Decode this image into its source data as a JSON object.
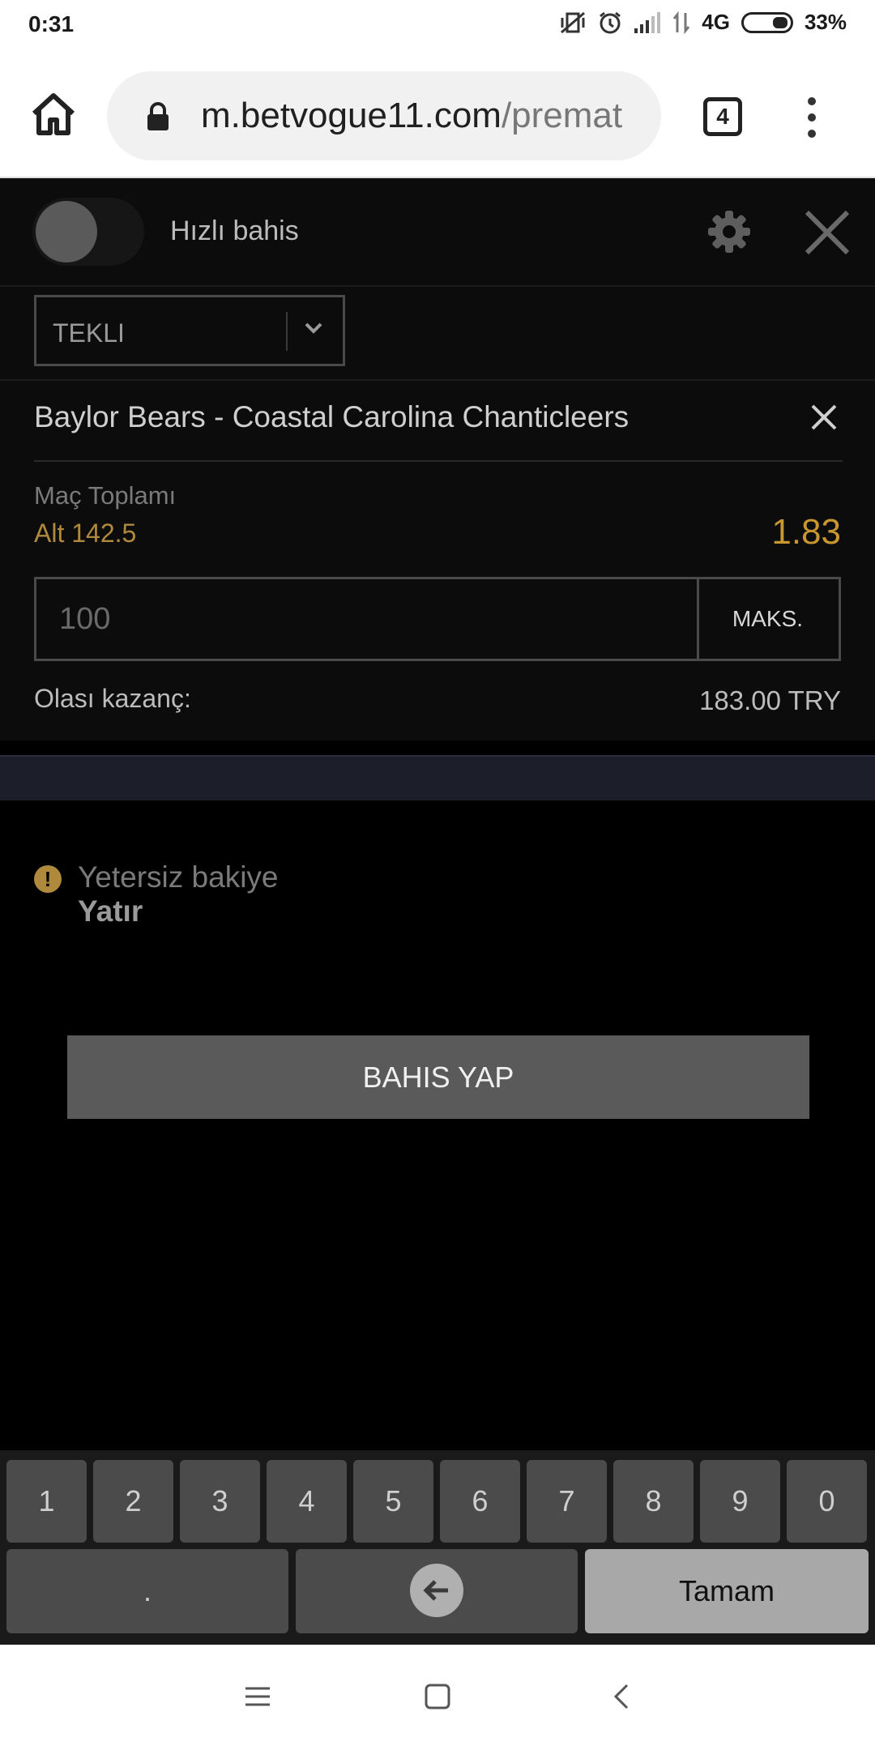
{
  "status": {
    "time": "0:31",
    "network": "4G",
    "battery": "33%"
  },
  "browser": {
    "url_host": "m.betvogue11.com",
    "url_path": "/premat",
    "tab_count": "4"
  },
  "quick_bet": {
    "label": "Hızlı bahis"
  },
  "bet_type": {
    "selected": "TEKLI"
  },
  "bet": {
    "match": "Baylor Bears - Coastal Carolina Chanticleers",
    "market": "Maç Toplamı",
    "selection": "Alt 142.5",
    "odds": "1.83",
    "stake_placeholder": "100",
    "max_label": "MAKS.",
    "potential_win_label": "Olası kazanç:",
    "potential_win_value": "183.00 TRY"
  },
  "warning": {
    "message": "Yetersiz bakiye",
    "link": "Yatır"
  },
  "actions": {
    "place_bet": "BAHIS YAP"
  },
  "keyboard": {
    "digits": [
      "1",
      "2",
      "3",
      "4",
      "5",
      "6",
      "7",
      "8",
      "9",
      "0"
    ],
    "dot": ".",
    "done": "Tamam"
  },
  "colors": {
    "accent": "#c9972f",
    "background": "#000000",
    "panel": "#0c0c0c"
  }
}
